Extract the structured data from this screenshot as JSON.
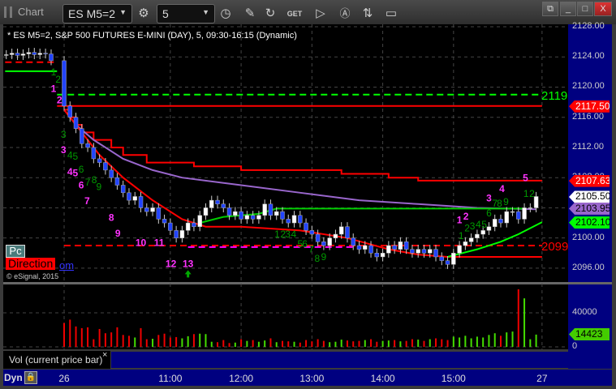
{
  "window": {
    "title": "Chart",
    "symbol": "ES M5=2",
    "interval": "5"
  },
  "header": "* ES M5=2, S&P 500 FUTURES E-MINI (DAY), 5, 09:30-16:15 (Dynamic)",
  "overlays": {
    "pc": "Pc",
    "direction": "Direction",
    "om": "om",
    "copyright": "© eSignal, 2015"
  },
  "volume_pane": {
    "label": "Vol (current price bar)",
    "close": "×",
    "ticks": [
      "40000",
      "0"
    ],
    "current": "14423"
  },
  "bottom": {
    "dyn": "Dyn"
  },
  "price_ticks": [
    "2128.00",
    "2124.00",
    "2120.00",
    "2116.00",
    "2112.00",
    "2108.00",
    "2100.00",
    "2096.00"
  ],
  "price_tags": [
    {
      "text": "2117.50",
      "price": 2117.5,
      "bg": "#ff0000",
      "fg": "#ffffff"
    },
    {
      "text": "2107.63",
      "price": 2107.63,
      "bg": "#ff0000",
      "fg": "#ffffff"
    },
    {
      "text": "2105.50",
      "price": 2105.5,
      "bg": "#ffffff",
      "fg": "#000000"
    },
    {
      "text": "2103.95",
      "price": 2103.95,
      "bg": "#9966cc",
      "fg": "#000000"
    },
    {
      "text": "2102.10",
      "price": 2102.1,
      "bg": "#00ff00",
      "fg": "#000000"
    }
  ],
  "chart_data": {
    "type": "candlestick",
    "title": "ES M5=2, S&P 500 FUTURES E-MINI (DAY), 5",
    "ylim": [
      2095,
      2129
    ],
    "time_ticks": [
      {
        "label": "26",
        "bar": 0
      },
      {
        "label": "11:00",
        "bar": 18
      },
      {
        "label": "12:00",
        "bar": 30
      },
      {
        "label": "13:00",
        "bar": 42
      },
      {
        "label": "14:00",
        "bar": 54
      },
      {
        "label": "15:00",
        "bar": 66
      },
      {
        "label": "27",
        "bar": 81
      }
    ],
    "premarket_closes": [
      2124.3,
      2124.5,
      2124.2,
      2124.4,
      2124.6,
      2124.3,
      2124.5,
      2124.4,
      2123.5
    ],
    "closes": [
      2117.5,
      2116,
      2114.5,
      2112.5,
      2112,
      2110.5,
      2110,
      2109,
      2108,
      2107,
      2106,
      2105,
      2105.5,
      2104,
      2103.5,
      2104,
      2102.5,
      2102,
      2101,
      2100,
      2101,
      2102,
      2101.5,
      2103,
      2104,
      2105,
      2104.5,
      2104,
      2103,
      2103.5,
      2102.5,
      2103,
      2102.5,
      2103,
      2104.5,
      2103,
      2103.5,
      2102.5,
      2102,
      2103,
      2102,
      2101,
      2100.5,
      2099.5,
      2099,
      2100,
      2100.5,
      2101.5,
      2100,
      2099,
      2098.5,
      2099,
      2098,
      2097.5,
      2098,
      2099,
      2098.5,
      2099.5,
      2098.5,
      2098,
      2098.5,
      2098,
      2098.5,
      2097.5,
      2097,
      2096.5,
      2098,
      2099,
      2099.5,
      2100,
      2100.5,
      2101,
      2101.5,
      2102.5,
      2102,
      2103.5,
      2103.5,
      2102.5,
      2104,
      2104,
      2105.5
    ],
    "volumes": [
      28000,
      32000,
      24000,
      22000,
      23000,
      9000,
      21000,
      16000,
      17000,
      23000,
      14000,
      13000,
      11000,
      22000,
      9000,
      9500,
      14000,
      15500,
      11000,
      11500,
      10000,
      12500,
      15000,
      15500,
      15000,
      6000,
      5500,
      8000,
      4500,
      5000,
      9000,
      7000,
      8000,
      6000,
      7500,
      10000,
      5500,
      7000,
      6500,
      6000,
      5000,
      8000,
      6500,
      9000,
      7000,
      5500,
      6000,
      8500,
      7500,
      6500,
      7000,
      8000,
      9000,
      6000,
      7000,
      7500,
      8000,
      6500,
      7000,
      9000,
      8500,
      7000,
      9000,
      10000,
      9000,
      8000,
      12000,
      11000,
      13000,
      10000,
      12000,
      11000,
      14000,
      16000,
      13000,
      17000,
      18000,
      67600,
      57000,
      9000,
      14423
    ],
    "levels": [
      {
        "name": "2119",
        "price": 2119,
        "color": "#00ff00",
        "style": "dashed",
        "from": -1.2,
        "to": 81
      },
      {
        "name": "2117.50",
        "price": 2117.5,
        "color": "#ff0000",
        "style": "solid",
        "from": -1.2,
        "to": 81
      },
      {
        "name": "2099",
        "price": 2099,
        "color": "#ff0000",
        "style": "dashed",
        "from": 0,
        "to": 81
      },
      {
        "name": "pivot",
        "price": 2098.8,
        "color": "#ff00ff",
        "style": "dashed",
        "from": 21,
        "to": 49
      },
      {
        "name": "pre-red",
        "price": 2123.3,
        "color": "#ff0000",
        "style": "dashed",
        "from": -10,
        "to": -1.2
      },
      {
        "name": "pre-green",
        "price": 2122.1,
        "color": "#00ff00",
        "style": "solid",
        "from": -10,
        "to": -1.2
      }
    ],
    "level_labels": [
      {
        "text": "2119",
        "price": 2119,
        "color": "#00ff00"
      },
      {
        "text": "2099",
        "price": 2099,
        "color": "#ff0000"
      }
    ],
    "lines": [
      {
        "name": "resistance-step",
        "color": "#ff0000",
        "step": true,
        "points": [
          [
            0,
            2117
          ],
          [
            1,
            2116
          ],
          [
            2,
            2115
          ],
          [
            3,
            2114
          ],
          [
            5,
            2113
          ],
          [
            8,
            2112
          ],
          [
            10,
            2111
          ],
          [
            14,
            2110
          ],
          [
            22,
            2109.5
          ],
          [
            30,
            2109
          ],
          [
            40,
            2109
          ],
          [
            47,
            2108.5
          ],
          [
            55,
            2108
          ],
          [
            60,
            2107.6
          ],
          [
            81,
            2107.6
          ]
        ]
      },
      {
        "name": "purple-average",
        "color": "#9966cc",
        "step": false,
        "points": [
          [
            0,
            2117
          ],
          [
            2,
            2115
          ],
          [
            5,
            2113
          ],
          [
            10,
            2110.5
          ],
          [
            15,
            2109
          ],
          [
            20,
            2108
          ],
          [
            30,
            2107
          ],
          [
            40,
            2106
          ],
          [
            50,
            2105
          ],
          [
            60,
            2104.5
          ],
          [
            70,
            2104
          ],
          [
            80,
            2103.8
          ]
        ]
      },
      {
        "name": "red-average",
        "color": "#ff0000",
        "step": false,
        "points": [
          [
            0,
            2117
          ],
          [
            3,
            2114
          ],
          [
            6,
            2111
          ],
          [
            10,
            2108
          ],
          [
            15,
            2105
          ],
          [
            20,
            2102.5
          ],
          [
            24,
            2101.5
          ],
          [
            30,
            2101.5
          ],
          [
            40,
            2101
          ],
          [
            48,
            2100
          ],
          [
            55,
            2098.5
          ],
          [
            60,
            2097.8
          ],
          [
            65,
            2097.5
          ],
          [
            81,
            2097.5
          ]
        ]
      },
      {
        "name": "green-average",
        "color": "#00cc00",
        "step": false,
        "points": [
          [
            23,
            2102
          ],
          [
            27,
            2102.8
          ],
          [
            33,
            2103.2
          ],
          [
            36,
            2103.9
          ],
          [
            78,
            2103.9
          ]
        ]
      },
      {
        "name": "green-rising",
        "color": "#00ff00",
        "step": false,
        "points": [
          [
            65,
            2097.5
          ],
          [
            70,
            2098.5
          ],
          [
            74,
            2099.5
          ],
          [
            77,
            2100.5
          ],
          [
            81,
            2102.1
          ]
        ]
      }
    ],
    "count_labels": [
      {
        "t": "1",
        "b": -1.8,
        "p": 2119.9,
        "c": "#ff33ff"
      },
      {
        "t": "2",
        "b": -0.8,
        "p": 2118.4,
        "c": "#ff33ff"
      },
      {
        "t": "3",
        "b": -0.1,
        "p": 2111.8,
        "c": "#ff33ff"
      },
      {
        "t": "4",
        "b": 1,
        "p": 2108.9,
        "c": "#ff33ff"
      },
      {
        "t": "5",
        "b": 1.9,
        "p": 2108.7,
        "c": "#ff33ff"
      },
      {
        "t": "6",
        "b": 2.9,
        "p": 2107.1,
        "c": "#ff33ff"
      },
      {
        "t": "7",
        "b": 3.9,
        "p": 2105,
        "c": "#ff33ff"
      },
      {
        "t": "8",
        "b": 8,
        "p": 2102.8,
        "c": "#ff33ff"
      },
      {
        "t": "9",
        "b": 9.1,
        "p": 2100.7,
        "c": "#ff33ff"
      },
      {
        "t": "10",
        "b": 13,
        "p": 2099.5,
        "c": "#ff33ff"
      },
      {
        "t": "11",
        "b": 16.1,
        "p": 2099.5,
        "c": "#ff33ff"
      },
      {
        "t": "12",
        "b": 18.1,
        "p": 2096.7,
        "c": "#ff33ff"
      },
      {
        "t": "13",
        "b": 21,
        "p": 2096.7,
        "c": "#ff33ff"
      },
      {
        "t": "1",
        "b": 67,
        "p": 2102.5,
        "c": "#ff33ff"
      },
      {
        "t": "2",
        "b": 68.1,
        "p": 2103,
        "c": "#ff33ff"
      },
      {
        "t": "3",
        "b": 72,
        "p": 2105.4,
        "c": "#ff33ff"
      },
      {
        "t": "4",
        "b": 74.2,
        "p": 2106.6,
        "c": "#ff33ff"
      },
      {
        "t": "5",
        "b": 78.2,
        "p": 2108.1,
        "c": "#ff33ff"
      },
      {
        "t": "1",
        "b": -1.8,
        "p": 2122.1,
        "c": "#009900"
      },
      {
        "t": "2",
        "b": -1,
        "p": 2121.1,
        "c": "#009900"
      },
      {
        "t": "3",
        "b": -0.1,
        "p": 2113.8,
        "c": "#009900"
      },
      {
        "t": "4",
        "b": 1,
        "p": 2111.1,
        "c": "#009900"
      },
      {
        "t": "5",
        "b": 1.9,
        "p": 2110.9,
        "c": "#009900"
      },
      {
        "t": "6",
        "b": 2.9,
        "p": 2109.2,
        "c": "#009900"
      },
      {
        "t": "7",
        "b": 4,
        "p": 2107.5,
        "c": "#009900"
      },
      {
        "t": "8",
        "b": 5.1,
        "p": 2107.8,
        "c": "#009900"
      },
      {
        "t": "9",
        "b": 5.9,
        "p": 2106.9,
        "c": "#009900"
      },
      {
        "t": "1",
        "b": 36.1,
        "p": 2100.6,
        "c": "#009900"
      },
      {
        "t": "2",
        "b": 37.1,
        "p": 2100.6,
        "c": "#009900"
      },
      {
        "t": "3",
        "b": 37.9,
        "p": 2100.6,
        "c": "#009900"
      },
      {
        "t": "4",
        "b": 38.9,
        "p": 2100.6,
        "c": "#009900"
      },
      {
        "t": "5",
        "b": 40,
        "p": 2099.3,
        "c": "#009900"
      },
      {
        "t": "6",
        "b": 40.8,
        "p": 2099.3,
        "c": "#009900"
      },
      {
        "t": "7",
        "b": 41.9,
        "p": 2098.6,
        "c": "#009900"
      },
      {
        "t": "8",
        "b": 42.9,
        "p": 2097.4,
        "c": "#009900"
      },
      {
        "t": "9",
        "b": 44,
        "p": 2097.6,
        "c": "#009900"
      },
      {
        "t": "1",
        "b": 67.3,
        "p": 2100.4,
        "c": "#009900"
      },
      {
        "t": "2",
        "b": 68.3,
        "p": 2101.4,
        "c": "#009900"
      },
      {
        "t": "3",
        "b": 69.2,
        "p": 2101.7,
        "c": "#009900"
      },
      {
        "t": "4",
        "b": 70.2,
        "p": 2101.9,
        "c": "#009900"
      },
      {
        "t": "5",
        "b": 71.2,
        "p": 2101.9,
        "c": "#009900"
      },
      {
        "t": "6",
        "b": 72,
        "p": 2103.4,
        "c": "#009900"
      },
      {
        "t": "7",
        "b": 73,
        "p": 2104.7,
        "c": "#009900"
      },
      {
        "t": "8",
        "b": 73.8,
        "p": 2104.7,
        "c": "#009900"
      },
      {
        "t": "9",
        "b": 74.9,
        "p": 2104.9,
        "c": "#009900"
      },
      {
        "t": "1",
        "b": 78.3,
        "p": 2106,
        "c": "#009900"
      },
      {
        "t": "2",
        "b": 79.3,
        "p": 2106,
        "c": "#009900"
      }
    ],
    "signal_arrows": [
      {
        "bar": 21,
        "price": 2095.2,
        "direction": "up",
        "color": "#00aa00"
      }
    ]
  }
}
